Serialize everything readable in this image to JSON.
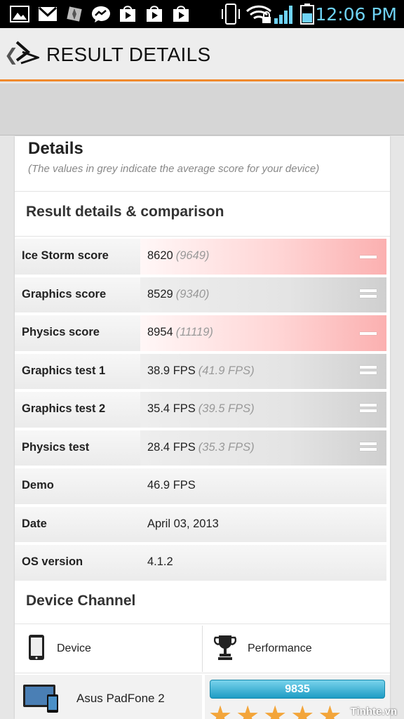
{
  "status_bar": {
    "time": "12:06 PM",
    "icons": [
      "gallery-icon",
      "gmail-icon",
      "pinwheel-icon",
      "messenger-icon",
      "play-store-icon",
      "play-store-icon",
      "play-store-icon",
      "vibrate-icon",
      "wifi-lock-icon",
      "signal-icon",
      "battery-icon"
    ]
  },
  "header": {
    "title": "RESULT DETAILS"
  },
  "details": {
    "title": "Details",
    "subtitle": "(The values in grey indicate the average score for your device)",
    "section_title": "Result details & comparison",
    "rows": [
      {
        "label": "Ice Storm score",
        "value": "8620",
        "average": "(9649)",
        "compare": "below"
      },
      {
        "label": "Graphics score",
        "value": "8529",
        "average": "(9340)",
        "compare": "equal"
      },
      {
        "label": "Physics score",
        "value": "8954",
        "average": "(11119)",
        "compare": "below"
      },
      {
        "label": "Graphics test 1",
        "value": "38.9 FPS",
        "average": "(41.9 FPS)",
        "compare": "equal"
      },
      {
        "label": "Graphics test 2",
        "value": "35.4 FPS",
        "average": "(39.5 FPS)",
        "compare": "equal"
      },
      {
        "label": "Physics test",
        "value": "28.4 FPS",
        "average": "(35.3 FPS)",
        "compare": "equal"
      },
      {
        "label": "Demo",
        "value": "46.9 FPS",
        "average": "",
        "compare": "none"
      },
      {
        "label": "Date",
        "value": "April 03, 2013",
        "average": "",
        "compare": "none"
      },
      {
        "label": "OS version",
        "value": "4.1.2",
        "average": "",
        "compare": "none"
      }
    ]
  },
  "device_channel": {
    "title": "Device Channel",
    "col_device": "Device",
    "col_performance": "Performance",
    "device_name": "Asus PadFone 2",
    "score": "9835",
    "stars": 5
  },
  "watermark": "Tinhte.vn",
  "colors": {
    "accent": "#f0892c",
    "bar": "#2aa6cc",
    "star": "#f3a53a",
    "below": "#fbb0b0"
  }
}
